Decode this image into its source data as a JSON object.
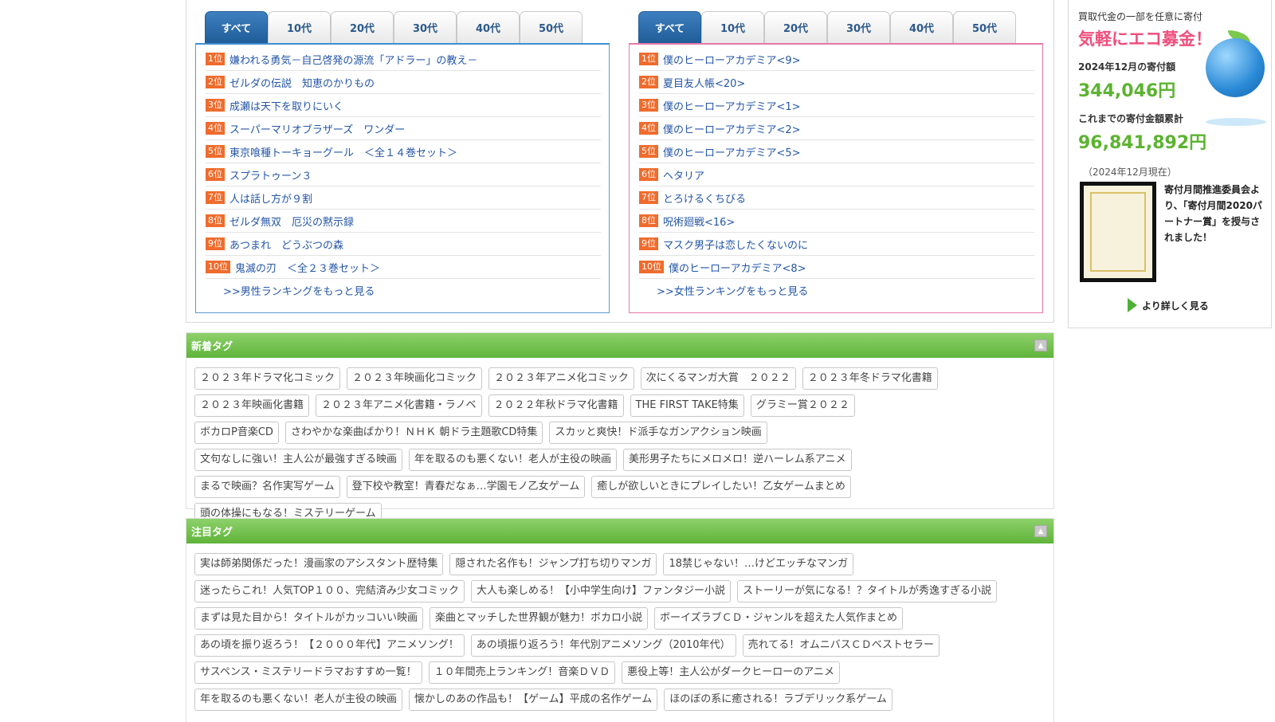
{
  "tabs": [
    "すべて",
    "10代",
    "20代",
    "30代",
    "40代",
    "50代"
  ],
  "male_ranking": {
    "items": [
      {
        "rank": "1位",
        "title": "嫌われる勇気－自己啓発の源流「アドラー」の教え－"
      },
      {
        "rank": "2位",
        "title": "ゼルダの伝説　知恵のかりもの"
      },
      {
        "rank": "3位",
        "title": "成瀬は天下を取りにいく"
      },
      {
        "rank": "4位",
        "title": "スーパーマリオブラザーズ　ワンダー"
      },
      {
        "rank": "5位",
        "title": "東京喰種トーキョーグール　＜全１４巻セット＞"
      },
      {
        "rank": "6位",
        "title": "スプラトゥーン３"
      },
      {
        "rank": "7位",
        "title": "人は話し方が９割"
      },
      {
        "rank": "8位",
        "title": "ゼルダ無双　厄災の黙示録"
      },
      {
        "rank": "9位",
        "title": "あつまれ　どうぶつの森"
      },
      {
        "rank": "10位",
        "title": "鬼滅の刃　＜全２３巻セット＞"
      }
    ],
    "more": ">>男性ランキングをもっと見る"
  },
  "female_ranking": {
    "items": [
      {
        "rank": "1位",
        "title": "僕のヒーローアカデミア<9>"
      },
      {
        "rank": "2位",
        "title": "夏目友人帳<20>"
      },
      {
        "rank": "3位",
        "title": "僕のヒーローアカデミア<1>"
      },
      {
        "rank": "4位",
        "title": "僕のヒーローアカデミア<2>"
      },
      {
        "rank": "5位",
        "title": "僕のヒーローアカデミア<5>"
      },
      {
        "rank": "6位",
        "title": "ヘタリア"
      },
      {
        "rank": "7位",
        "title": "とろけるくちびる"
      },
      {
        "rank": "8位",
        "title": "呪術廻戦<16>"
      },
      {
        "rank": "9位",
        "title": "マスク男子は恋したくないのに"
      },
      {
        "rank": "10位",
        "title": "僕のヒーローアカデミア<8>"
      }
    ],
    "more": ">>女性ランキングをもっと見る"
  },
  "new_tags": {
    "title": "新着タグ",
    "tags": [
      "２０２３年ドラマ化コミック",
      "２０２３年映画化コミック",
      "２０２３年アニメ化コミック",
      "次にくるマンガ大賞　２０２２",
      "２０２３年冬ドラマ化書籍",
      "２０２３年映画化書籍",
      "２０２３年アニメ化書籍・ラノベ",
      "２０２２年秋ドラマ化書籍",
      "THE FIRST TAKE特集",
      "グラミー賞２０２２",
      "ボカロP音楽CD",
      "さわやかな楽曲ばかり！ＮＨＫ 朝ドラ主題歌CD特集",
      "スカッと爽快！ド派手なガンアクション映画",
      "文句なしに強い！主人公が最強すぎる映画",
      "年を取るのも悪くない！老人が主役の映画",
      "美形男子たちにメロメロ！逆ハーレム系アニメ",
      "まるで映画？名作実写ゲーム",
      "登下校や教室！青春だなぁ…学園モノ乙女ゲーム",
      "癒しが欲しいときにプレイしたい！乙女ゲームまとめ",
      "頭の体操にもなる！ミステリーゲーム"
    ]
  },
  "featured_tags": {
    "title": "注目タグ",
    "tags": [
      "実は師弟関係だった！漫画家のアシスタント歴特集",
      "隠された名作も！ジャンプ打ち切りマンガ",
      "18禁じゃない！…けどエッチなマンガ",
      "迷ったらこれ！人気TOP１００、完結済み少女コミック",
      "大人も楽しめる！【小中学生向け】ファンタジー小説",
      "ストーリーが気になる！？タイトルが秀逸すぎる小説",
      "まずは見た目から！タイトルがカッコいい映画",
      "楽曲とマッチした世界観が魅力！ボカロ小説",
      "ボーイズラブＣＤ・ジャンルを超えた人気作まとめ",
      "あの頃を振り返ろう！【２０００年代】アニメソング！",
      "あの頃振り返ろう！年代別アニメソング（2010年代）",
      "売れてる！オムニバスＣＤベストセラー",
      "サスペンス・ミステリードラマおすすめ一覧！",
      "１０年間売上ランキング！音楽ＤＶＤ",
      "悪役上等！主人公がダークヒーローのアニメ",
      "年を取るのも悪くない！老人が主役の映画",
      "懐かしのあの作品も！【ゲーム】平成の名作ゲーム",
      "ほのぼの系に癒される！ラブデリック系ゲーム"
    ]
  },
  "sidebar": {
    "line1": "買取代金の一部を任意に寄付",
    "eco": "気軽にエコ募金！",
    "month_label": "2024年12月の寄付額",
    "month_amount": "344,046円",
    "total_label": "これまでの寄付金額累計",
    "total_amount": "96,841,892円",
    "note": "（2024年12月現在）",
    "cert_text": "寄付月間推進委員会より、「寄付月間2020パートナー賞」を授与されました！",
    "detail": "より詳しく見る"
  }
}
